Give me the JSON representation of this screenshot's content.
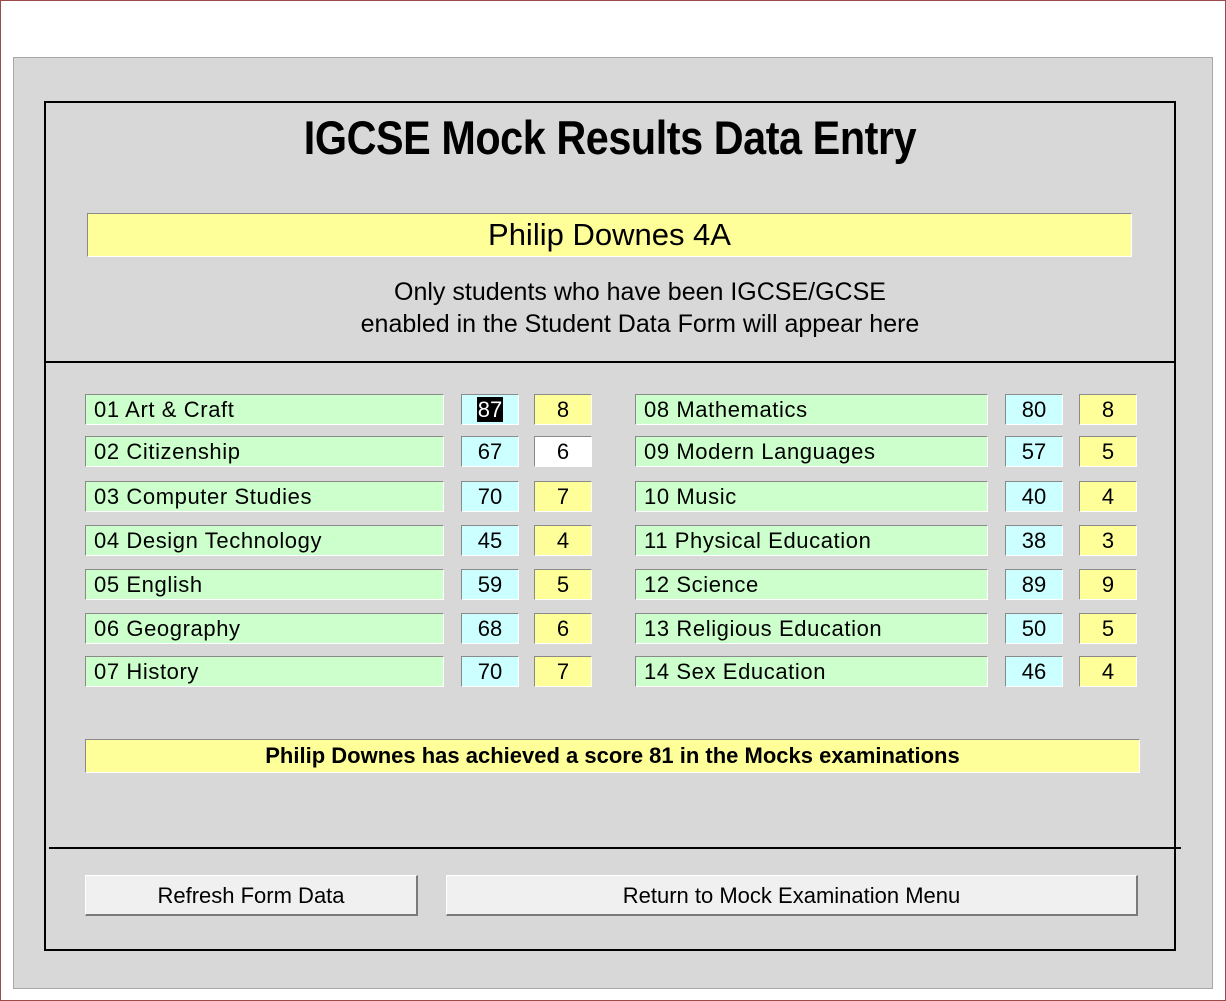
{
  "form": {
    "title": "IGCSE Mock Results Data Entry",
    "student_name": "Philip Downes 4A",
    "notice_line1": "Only students who have been IGCSE/GCSE",
    "notice_line2": "enabled in the Student Data Form will appear here"
  },
  "subjects_left": [
    {
      "subject": "01 Art & Craft",
      "mark": "87",
      "grade": "8"
    },
    {
      "subject": "02 Citizenship",
      "mark": "67",
      "grade": "6"
    },
    {
      "subject": "03 Computer Studies",
      "mark": "70",
      "grade": "7"
    },
    {
      "subject": "04 Design Technology",
      "mark": "45",
      "grade": "4"
    },
    {
      "subject": "05 English",
      "mark": "59",
      "grade": "5"
    },
    {
      "subject": "06 Geography",
      "mark": "68",
      "grade": "6"
    },
    {
      "subject": "07 History",
      "mark": "70",
      "grade": "7"
    }
  ],
  "subjects_right": [
    {
      "subject": "08 Mathematics",
      "mark": "80",
      "grade": "8"
    },
    {
      "subject": "09 Modern Languages",
      "mark": "57",
      "grade": "5"
    },
    {
      "subject": "10 Music",
      "mark": "40",
      "grade": "4"
    },
    {
      "subject": "11 Physical Education",
      "mark": "38",
      "grade": "3"
    },
    {
      "subject": "12 Science",
      "mark": "89",
      "grade": "9"
    },
    {
      "subject": "13 Religious Education",
      "mark": "50",
      "grade": "5"
    },
    {
      "subject": "14 Sex Education",
      "mark": "46",
      "grade": "4"
    }
  ],
  "summary": "Philip Downes has achieved a score 81 in the Mocks examinations",
  "buttons": {
    "refresh": "Refresh Form Data",
    "return": "Return to Mock Examination Menu"
  },
  "colors": {
    "background": "#d8d8d8",
    "subject_field": "#ccffcc",
    "mark_field": "#ccffff",
    "grade_field": "#ffff99",
    "name_field": "#ffff99"
  }
}
